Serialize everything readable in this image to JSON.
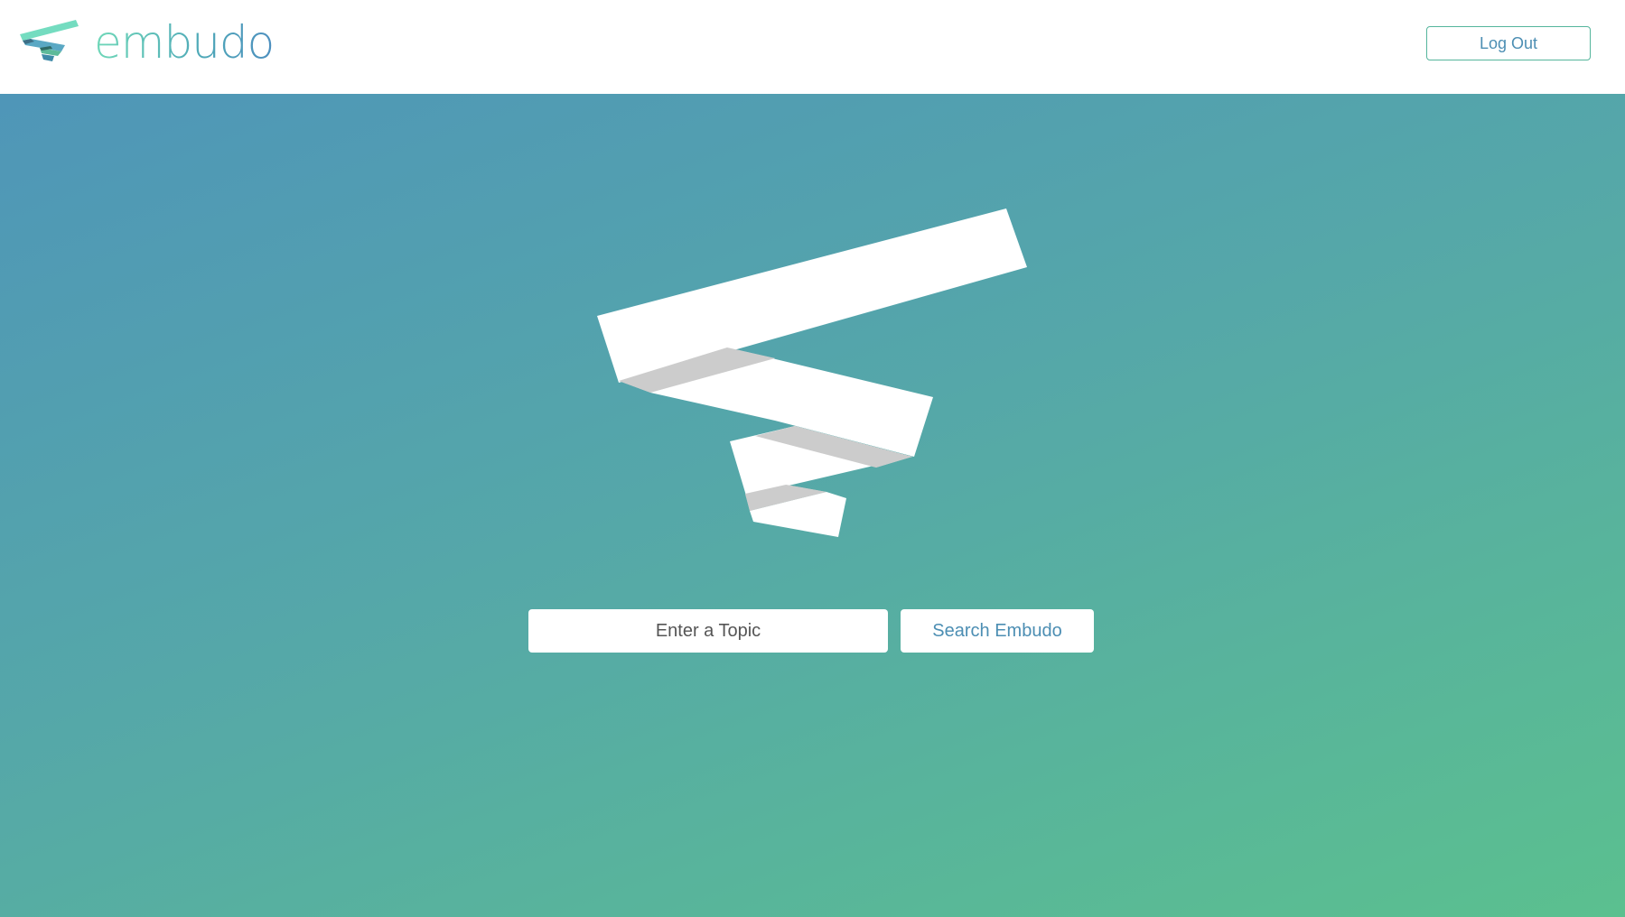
{
  "header": {
    "brand_name": "embudo",
    "logout_label": "Log Out"
  },
  "search": {
    "placeholder": "Enter a Topic",
    "value": "",
    "button_label": "Search Embudo"
  },
  "icons": {
    "brand_logo": "embudo-funnel-logo-icon",
    "hero_logo": "embudo-funnel-hero-icon"
  },
  "colors": {
    "accent_text": "#4c8eb3",
    "logout_border": "#55b59c",
    "gradient_start": "#4f96b8",
    "gradient_end": "#5bc08f",
    "ribbon_shadow": "#cccccc"
  }
}
